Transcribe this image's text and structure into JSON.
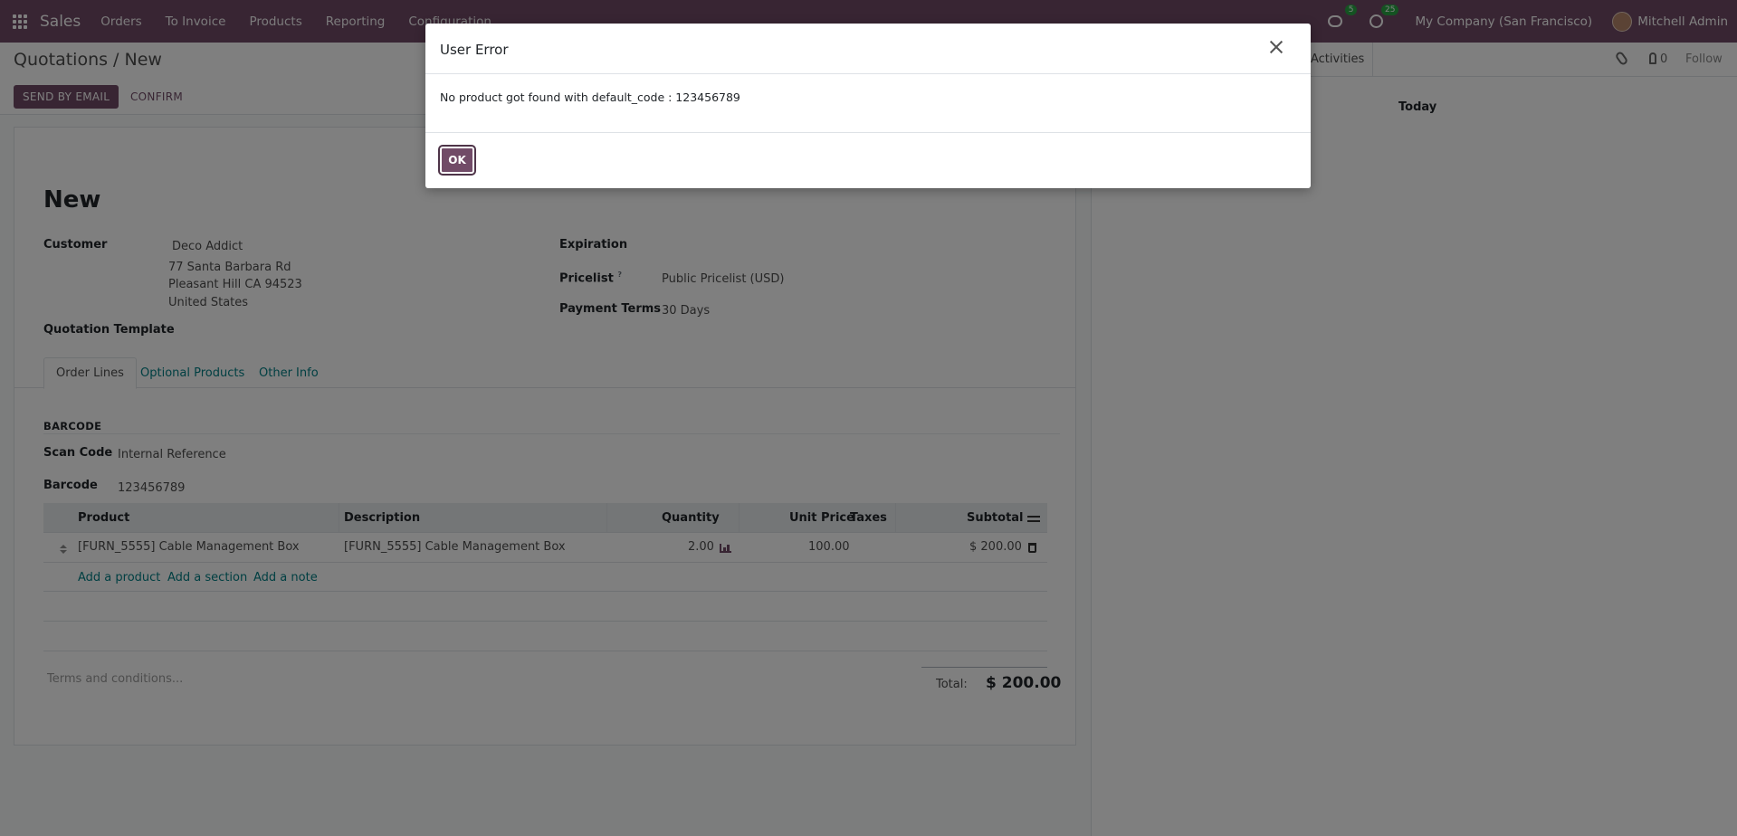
{
  "navbar": {
    "brand": "Sales",
    "menu": [
      "Orders",
      "To Invoice",
      "Products",
      "Reporting",
      "Configuration"
    ],
    "messages_badge": "5",
    "activities_badge": "25",
    "company": "My Company (San Francisco)",
    "user": "Mitchell Admin"
  },
  "control": {
    "breadcrumb": "Quotations / New",
    "send_email": "SEND BY EMAIL",
    "confirm": "CONFIRM"
  },
  "form": {
    "title": "New",
    "customer_label": "Customer",
    "customer_name": "Deco Addict",
    "address": [
      "77 Santa Barbara Rd",
      "Pleasant Hill CA 94523",
      "United States"
    ],
    "quotation_template_label": "Quotation Template",
    "expiration_label": "Expiration",
    "pricelist_label": "Pricelist",
    "pricelist_help": "?",
    "pricelist_value": "Public Pricelist (USD)",
    "payment_terms_label": "Payment Terms",
    "payment_terms_value": "30 Days",
    "tabs": [
      "Order Lines",
      "Optional Products",
      "Other Info"
    ],
    "barcode_section": "BARCODE",
    "scan_code_label": "Scan Code",
    "scan_code_value": "Internal Reference",
    "barcode_label": "Barcode",
    "barcode_value": "123456789",
    "table": {
      "headers": {
        "product": "Product",
        "description": "Description",
        "quantity": "Quantity",
        "unit_price": "Unit Price",
        "taxes": "Taxes",
        "subtotal": "Subtotal"
      },
      "rows": [
        {
          "product": "[FURN_5555] Cable Management Box",
          "description": "[FURN_5555] Cable Management Box",
          "quantity": "2.00",
          "unit_price": "100.00",
          "taxes": "",
          "subtotal": "$ 200.00"
        }
      ],
      "add_product": "Add a product",
      "add_section": "Add a section",
      "add_note": "Add a note"
    },
    "terms_placeholder": "Terms and conditions...",
    "total_label": "Total:",
    "total_value": "$ 200.00"
  },
  "chatter": {
    "activities": "Activities",
    "followers_count": "0",
    "follow": "Follow",
    "today": "Today"
  },
  "dialog": {
    "title": "User Error",
    "message": "No product got found with default_code : 123456789",
    "ok": "OK"
  },
  "colors": {
    "brand": "#714b67",
    "link": "#017e84",
    "badge": "#28a745"
  }
}
